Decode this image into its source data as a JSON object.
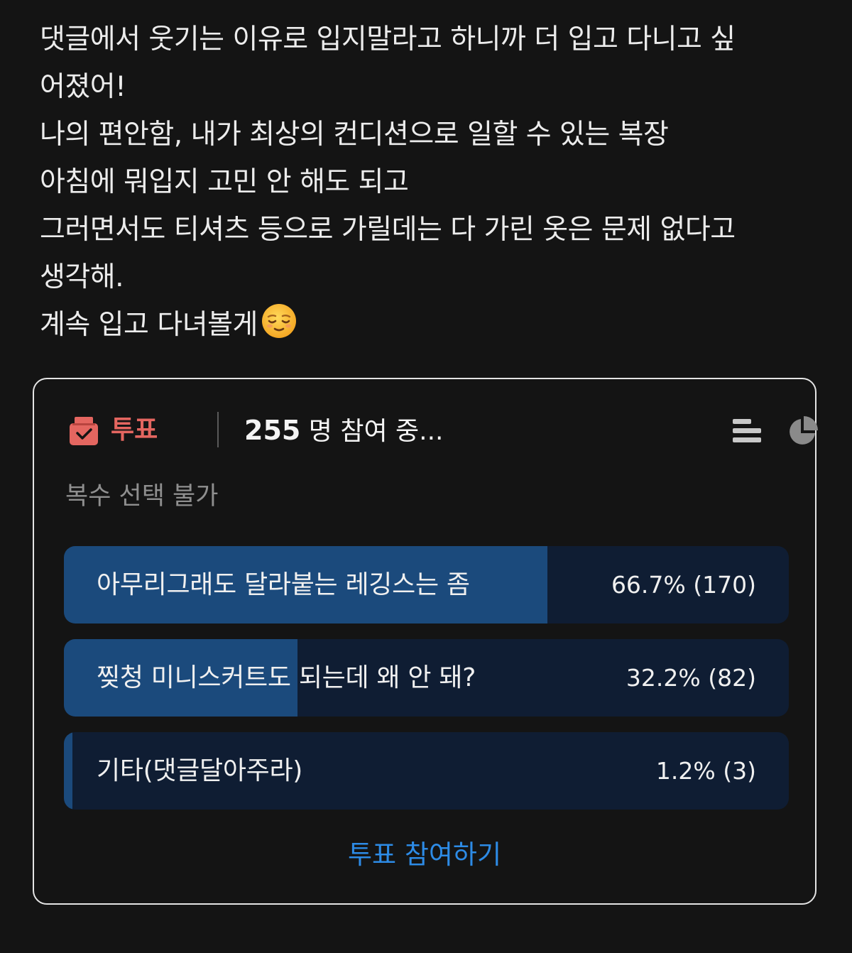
{
  "post": {
    "lines": [
      "댓글에서 웃기는 이유로 입지말라고 하니까 더 입고 다니고 싶",
      "어졌어!",
      "나의 편안함, 내가 최상의 컨디션으로 일할 수 있는 복장",
      "아침에 뭐입지 고민 안 해도 되고",
      "그러면서도 티셔츠 등으로 가릴데는 다 가린 옷은 문제 없다고",
      "생각해.",
      "계속 입고 다녀볼게"
    ],
    "emoji_icon": "relieved-face-emoji"
  },
  "poll": {
    "label": "투표",
    "participant_count": "255",
    "participant_suffix": " 명 참여 중...",
    "multi_select_note": "복수 선택 불가",
    "options": [
      {
        "label": "아무리그래도 달라붙는 레깅스는 좀",
        "result": "66.7% (170)",
        "percent": 66.7
      },
      {
        "label": "찢청 미니스커트도 되는데 왜 안 돼?",
        "result": "32.2% (82)",
        "percent": 32.2
      },
      {
        "label": "기타(댓글달아주라)",
        "result": "1.2% (3)",
        "percent": 1.2
      }
    ],
    "join_label": "투표 참여하기",
    "icons": {
      "vote": "ballot-box-icon",
      "list_view": "list-view-icon",
      "chart_view": "pie-chart-icon"
    }
  },
  "colors": {
    "background": "#141414",
    "vote_accent": "#e46660",
    "option_fill": "#1b4a7c",
    "option_track": "#0f1d33",
    "link": "#2d8be6"
  }
}
